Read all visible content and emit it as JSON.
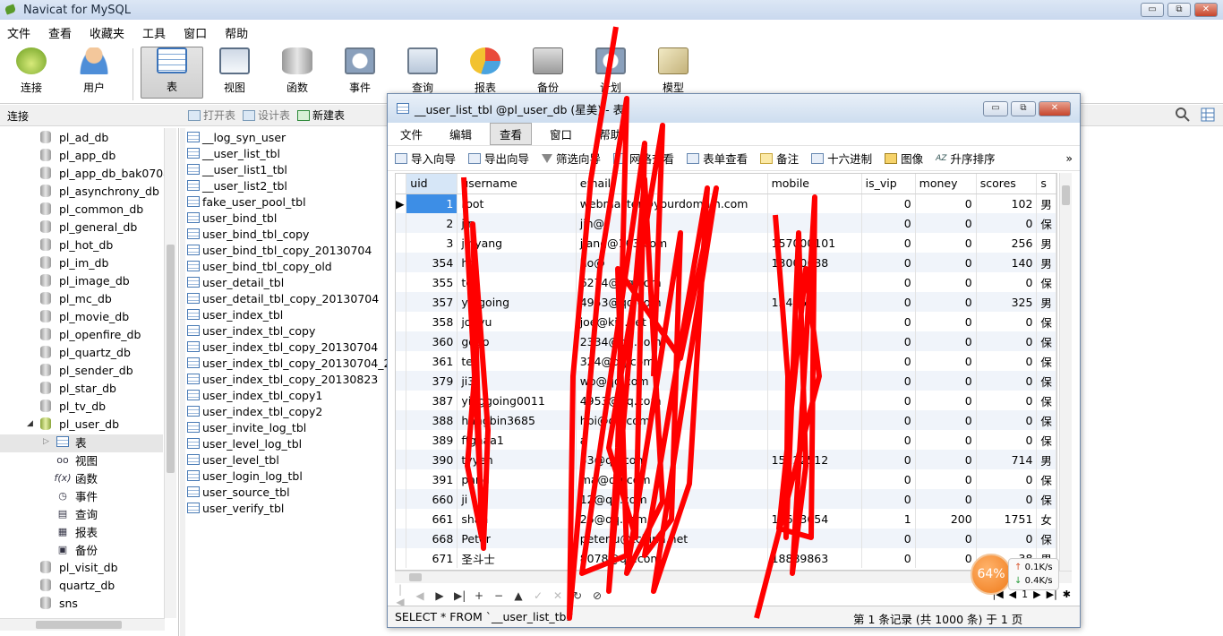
{
  "app": {
    "title": "Navicat for MySQL"
  },
  "window_controls": {
    "minimize": "▭",
    "restore": "⧉",
    "close": "✕"
  },
  "menu": [
    "文件",
    "查看",
    "收藏夹",
    "工具",
    "窗口",
    "帮助"
  ],
  "toolbar": {
    "items": [
      {
        "label": "连接",
        "icon": "connection-icon"
      },
      {
        "label": "用户",
        "icon": "user-icon"
      },
      {
        "label": "表",
        "icon": "table-icon",
        "active": true
      },
      {
        "label": "视图",
        "icon": "view-icon"
      },
      {
        "label": "函数",
        "icon": "function-icon"
      },
      {
        "label": "事件",
        "icon": "event-icon"
      },
      {
        "label": "查询",
        "icon": "query-icon"
      },
      {
        "label": "报表",
        "icon": "report-icon"
      },
      {
        "label": "备份",
        "icon": "backup-icon"
      },
      {
        "label": "计划",
        "icon": "schedule-icon"
      },
      {
        "label": "模型",
        "icon": "model-icon"
      }
    ]
  },
  "connbar": {
    "label": "连接",
    "tools": [
      "打开表",
      "设计表",
      "新建表"
    ]
  },
  "sidebar": {
    "databases": [
      "pl_ad_db",
      "pl_app_db",
      "pl_app_db_bak0704",
      "pl_asynchrony_db",
      "pl_common_db",
      "pl_general_db",
      "pl_hot_db",
      "pl_im_db",
      "pl_image_db",
      "pl_mc_db",
      "pl_movie_db",
      "pl_openfire_db",
      "pl_quartz_db",
      "pl_sender_db",
      "pl_star_db",
      "pl_tv_db",
      "pl_user_db"
    ],
    "expanded_children": [
      {
        "label": "表",
        "icon": "table-icon"
      },
      {
        "label": "视图",
        "icon": "view-icon"
      },
      {
        "label": "函数",
        "icon": "function-icon"
      },
      {
        "label": "事件",
        "icon": "event-icon"
      },
      {
        "label": "查询",
        "icon": "query-icon"
      },
      {
        "label": "报表",
        "icon": "report-icon"
      },
      {
        "label": "备份",
        "icon": "backup-icon"
      }
    ],
    "after": [
      "pl_visit_db",
      "quartz_db",
      "sns"
    ]
  },
  "table_list": [
    "__log_syn_user",
    "__user_list_tbl",
    "__user_list1_tbl",
    "__user_list2_tbl",
    "fake_user_pool_tbl",
    "user_bind_tbl",
    "user_bind_tbl_copy",
    "user_bind_tbl_copy_20130704",
    "user_bind_tbl_copy_old",
    "user_detail_tbl",
    "user_detail_tbl_copy_20130704",
    "user_index_tbl",
    "user_index_tbl_copy",
    "user_index_tbl_copy_20130704",
    "user_index_tbl_copy_20130704_2",
    "user_index_tbl_copy_20130823",
    "user_index_tbl_copy1",
    "user_index_tbl_copy2",
    "user_invite_log_tbl",
    "user_level_log_tbl",
    "user_level_tbl",
    "user_login_log_tbl",
    "user_source_tbl",
    "user_verify_tbl"
  ],
  "child": {
    "title": "__user_list_tbl @pl_user_db (星美) - 表",
    "menu": [
      "文件",
      "编辑",
      "查看",
      "窗口",
      "帮助"
    ],
    "toolbar": [
      "导入向导",
      "导出向导",
      "筛选向导",
      "网格查看",
      "表单查看",
      "备注",
      "十六进制",
      "图像",
      "升序排序"
    ],
    "columns": [
      "uid",
      "username",
      "email",
      "mobile",
      "is_vip",
      "money",
      "scores",
      "s"
    ],
    "rows": [
      [
        "1",
        "root",
        "webmaster@yourdomain.com",
        "",
        "0",
        "0",
        "102",
        "男"
      ],
      [
        "2",
        "jin",
        "jin@",
        "",
        "0",
        "0",
        "0",
        "保"
      ],
      [
        "3",
        "jinyang",
        "jiang@163.com",
        "157000101",
        "0",
        "0",
        "256",
        "男"
      ],
      [
        "354",
        "ho",
        "ho@",
        "13000688",
        "0",
        "0",
        "140",
        "男"
      ],
      [
        "355",
        "to",
        "6274@qq.com",
        "",
        "0",
        "0",
        "0",
        "保"
      ],
      [
        "357",
        "yingoing",
        "4953@qq.com",
        "13445",
        "0",
        "0",
        "325",
        "男"
      ],
      [
        "358",
        "joeyu",
        "joe@kia.net",
        "",
        "0",
        "0",
        "0",
        "保"
      ],
      [
        "360",
        "gogo",
        "2334@qq.com",
        "",
        "0",
        "0",
        "0",
        "保"
      ],
      [
        "361",
        "te",
        "324@qq.com",
        "",
        "0",
        "0",
        "0",
        "保"
      ],
      [
        "379",
        "ji3",
        "wo@qq.com",
        "",
        "0",
        "0",
        "0",
        "保"
      ],
      [
        "387",
        "yinggoing0011",
        "4953@qq.com",
        "",
        "0",
        "0",
        "0",
        "保"
      ],
      [
        "388",
        "hangbin3685",
        "hbi@qq.com",
        "",
        "0",
        "0",
        "0",
        "保"
      ],
      [
        "389",
        "ffgaaa1",
        "a",
        "",
        "0",
        "0",
        "0",
        "保"
      ],
      [
        "390",
        "tyyen",
        "53@qq.com",
        "15122512",
        "0",
        "0",
        "714",
        "男"
      ],
      [
        "391",
        "pang",
        "ma@qq.com",
        "",
        "0",
        "0",
        "0",
        "保"
      ],
      [
        "660",
        "ji",
        "12@qq.com",
        "",
        "0",
        "0",
        "0",
        "保"
      ],
      [
        "661",
        "shan",
        "26@qq.com",
        "15653654",
        "1",
        "200",
        "1751",
        "女"
      ],
      [
        "668",
        "Peter",
        "peterlu@tchina.net",
        "",
        "0",
        "0",
        "0",
        "保"
      ],
      [
        "671",
        "圣斗士",
        "8078@qq.com",
        "18889863",
        "0",
        "0",
        "38",
        "男"
      ]
    ],
    "status_sql": "SELECT * FROM `__user_list_tbl` LI",
    "status_records": "第 1 条记录 (共 1000 条) 于 1 页",
    "page_number": "1"
  },
  "speed": {
    "percent": "64%",
    "up": "0.1K/s",
    "down": "0.4K/s"
  },
  "colors": {
    "accent": "#3d8ee6",
    "scribble": "#ff0000"
  }
}
